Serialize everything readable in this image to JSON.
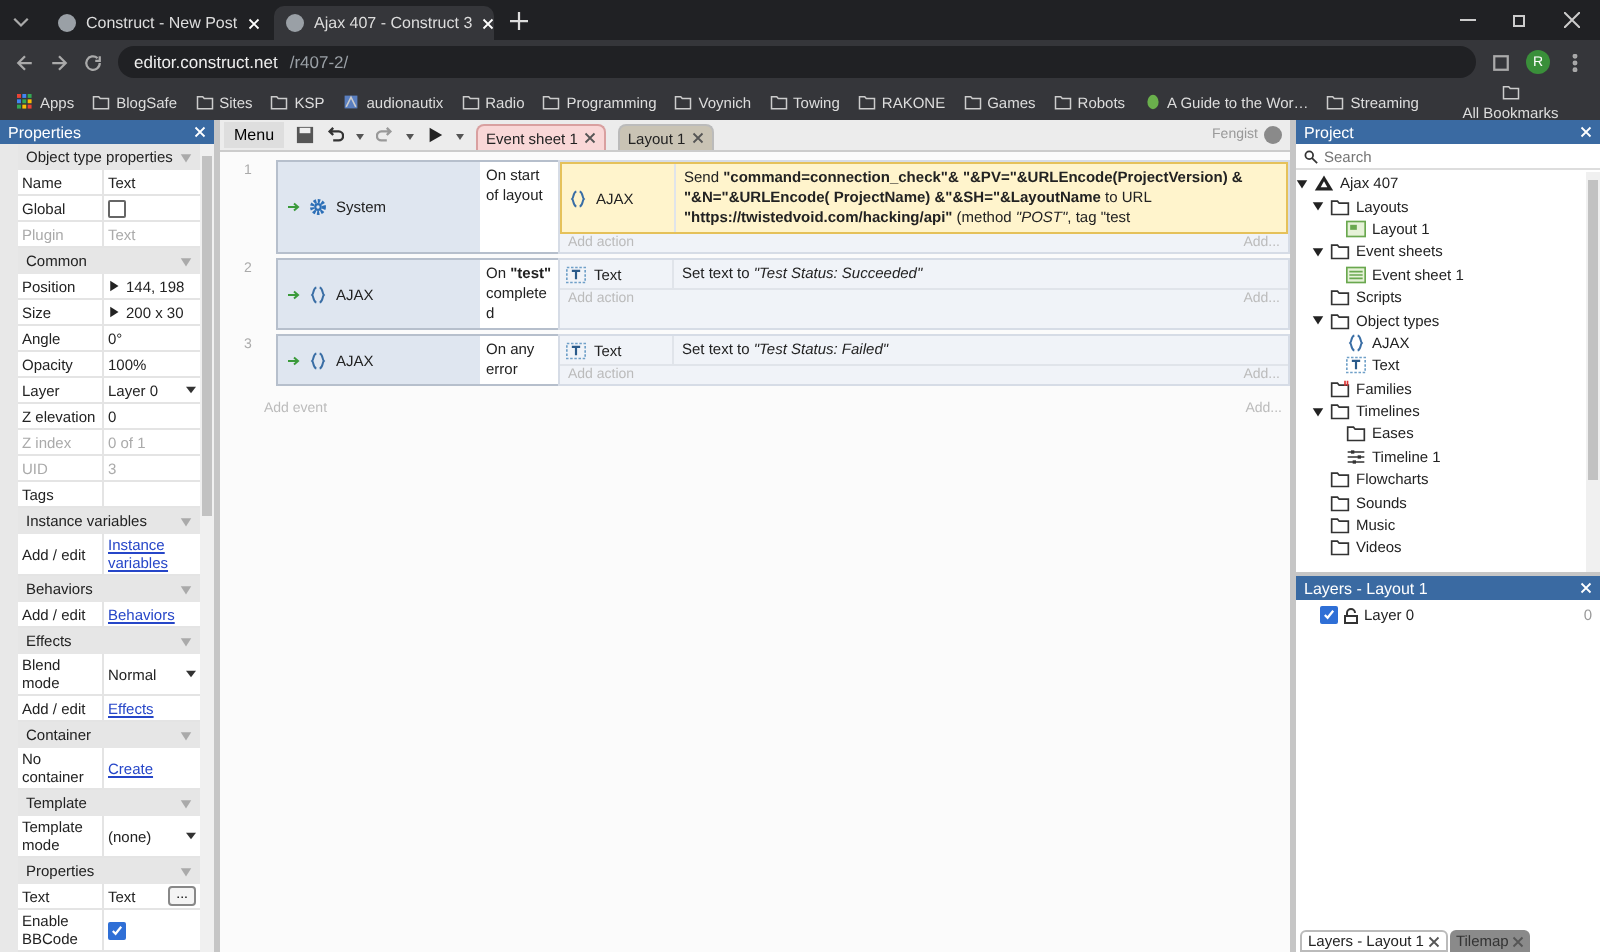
{
  "browser": {
    "tabs": [
      {
        "title": "Construct - New Post",
        "selected": false
      },
      {
        "title": "Ajax 407 - Construct 3",
        "selected": true
      }
    ],
    "url_host": "editor.construct.net",
    "url_path": "/r407-2/",
    "profile": "R",
    "bookmarks": [
      {
        "label": "Apps",
        "kind": "apps"
      },
      {
        "label": "BlogSafe",
        "kind": "folder"
      },
      {
        "label": "Sites",
        "kind": "folder"
      },
      {
        "label": "KSP",
        "kind": "folder"
      },
      {
        "label": "audionautix",
        "kind": "site"
      },
      {
        "label": "Radio",
        "kind": "folder"
      },
      {
        "label": "Programming",
        "kind": "folder"
      },
      {
        "label": "Voynich",
        "kind": "folder"
      },
      {
        "label": "Towing",
        "kind": "folder"
      },
      {
        "label": "RAKONE",
        "kind": "folder"
      },
      {
        "label": "Games",
        "kind": "folder"
      },
      {
        "label": "Robots",
        "kind": "folder"
      },
      {
        "label": "A Guide to the Wor…",
        "kind": "leaf"
      },
      {
        "label": "Streaming",
        "kind": "folder"
      }
    ],
    "all_bookmarks": "All Bookmarks"
  },
  "properties": {
    "title": "Properties",
    "sections": [
      {
        "title": "Object type properties",
        "expanded": true,
        "rows": [
          {
            "label": "Name",
            "kind": "text",
            "value": "Text",
            "disabled": false
          },
          {
            "label": "Global",
            "kind": "checkbox",
            "checked": false,
            "disabled": false
          },
          {
            "label": "Plugin",
            "kind": "text",
            "value": "Text",
            "disabled": true
          }
        ]
      },
      {
        "title": "Common",
        "expanded": true,
        "rows": [
          {
            "label": "Position",
            "kind": "group",
            "expanded": false,
            "value": "144, 198",
            "disabled": false
          },
          {
            "label": "Size",
            "kind": "group",
            "expanded": false,
            "value": "200 x 30",
            "disabled": false
          },
          {
            "label": "Angle",
            "kind": "text",
            "value": "0°",
            "disabled": false
          },
          {
            "label": "Opacity",
            "kind": "text",
            "value": "100%",
            "disabled": false
          },
          {
            "label": "Layer",
            "kind": "select",
            "value": "Layer 0",
            "disabled": false
          },
          {
            "label": "Z elevation",
            "kind": "text",
            "value": "0",
            "disabled": false
          },
          {
            "label": "Z index",
            "kind": "text",
            "value": "0 of 1",
            "disabled": true
          },
          {
            "label": "UID",
            "kind": "text",
            "value": "3",
            "disabled": true
          },
          {
            "label": "Tags",
            "kind": "text",
            "disabled": false
          }
        ]
      },
      {
        "title": "Instance variables",
        "expanded": true,
        "rows": [
          {
            "label": "Add / edit",
            "kind": "link",
            "value": "Instance variables",
            "disabled": false
          }
        ]
      },
      {
        "title": "Behaviors",
        "expanded": true,
        "rows": [
          {
            "label": "Add / edit",
            "kind": "link",
            "value": "Behaviors",
            "disabled": false
          }
        ]
      },
      {
        "title": "Effects",
        "expanded": true,
        "rows": [
          {
            "label": "Blend mode",
            "kind": "select",
            "value": "Normal",
            "disabled": false
          },
          {
            "label": "Add / edit",
            "kind": "link",
            "value": "Effects",
            "disabled": false
          }
        ]
      },
      {
        "title": "Container",
        "expanded": true,
        "rows": [
          {
            "label": "No container",
            "kind": "link",
            "value": "Create",
            "disabled": false
          }
        ]
      },
      {
        "title": "Template",
        "expanded": true,
        "rows": [
          {
            "label": "Template mode",
            "kind": "select",
            "value": "(none)",
            "disabled": false
          }
        ]
      },
      {
        "title": "Properties",
        "expanded": true,
        "rows": [
          {
            "label": "Text",
            "kind": "button",
            "value": "Text",
            "button": "...",
            "disabled": false
          },
          {
            "label": "Enable BBCode",
            "kind": "checkbox",
            "checked": true,
            "disabled": false
          }
        ]
      }
    ]
  },
  "toolbar": {
    "menu": "Menu",
    "tabs": [
      {
        "label": "Event sheet 1",
        "selected": true
      },
      {
        "label": "Layout 1",
        "selected": false
      }
    ],
    "user": "Fengist"
  },
  "events": [
    {
      "number": "1",
      "condition": {
        "object": "System",
        "kind": "system",
        "text": "On start of layout"
      },
      "actions": [
        {
          "object": "AJAX",
          "kind": "ajax",
          "selected": true,
          "text": "Send **\"command=connection_check\"& \"&PV=\"&URLEncode(ProjectVersion) & \"&N=\"&URLEncode( ProjectName) &\"&SH=\"&LayoutName** to URL **\"https://twistedvoid.com/hacking/api\"** (method *\"POST\"*, tag \"test"
        }
      ],
      "add_action": "Add action",
      "add_short": "Add..."
    },
    {
      "number": "2",
      "condition": {
        "object": "AJAX",
        "kind": "ajax",
        "text": "On **\"test\"** completed"
      },
      "actions": [
        {
          "object": "Text",
          "kind": "text",
          "selected": false,
          "text": "Set text to *\"Test Status: Succeeded\"*"
        }
      ],
      "add_action": "Add action",
      "add_short": "Add..."
    },
    {
      "number": "3",
      "condition": {
        "object": "AJAX",
        "kind": "ajax",
        "text": "On any error"
      },
      "actions": [
        {
          "object": "Text",
          "kind": "text",
          "selected": false,
          "text": "Set text to *\"Test Status: Failed\"*"
        }
      ],
      "add_action": "Add action",
      "add_short": "Add..."
    }
  ],
  "add_event": "Add event",
  "add_event_short": "Add...",
  "project": {
    "title": "Project",
    "search_placeholder": "Search",
    "tree": [
      {
        "label": "Ajax 407",
        "kind": "root",
        "expanded": true,
        "children": [
          {
            "label": "Layouts",
            "kind": "folder",
            "expanded": true,
            "children": [
              {
                "label": "Layout 1",
                "kind": "layout"
              }
            ]
          },
          {
            "label": "Event sheets",
            "kind": "folder",
            "expanded": true,
            "children": [
              {
                "label": "Event sheet 1",
                "kind": "eventsheet"
              }
            ]
          },
          {
            "label": "Scripts",
            "kind": "folder"
          },
          {
            "label": "Object types",
            "kind": "folder",
            "expanded": true,
            "children": [
              {
                "label": "AJAX",
                "kind": "ajax"
              },
              {
                "label": "Text",
                "kind": "text"
              }
            ]
          },
          {
            "label": "Families",
            "kind": "families"
          },
          {
            "label": "Timelines",
            "kind": "folder",
            "expanded": true,
            "children": [
              {
                "label": "Eases",
                "kind": "folder"
              },
              {
                "label": "Timeline 1",
                "kind": "timeline"
              }
            ]
          },
          {
            "label": "Flowcharts",
            "kind": "folder"
          },
          {
            "label": "Sounds",
            "kind": "folder"
          },
          {
            "label": "Music",
            "kind": "folder"
          },
          {
            "label": "Videos",
            "kind": "folder"
          }
        ]
      }
    ]
  },
  "layers": {
    "title": "Layers - Layout 1",
    "rows": [
      {
        "label": "Layer 0",
        "visible": true,
        "locked": false,
        "count": "0"
      }
    ]
  },
  "bottom_tabs": [
    {
      "label": "Layers - Layout 1",
      "selected": true
    },
    {
      "label": "Tilemap",
      "selected": false
    }
  ]
}
